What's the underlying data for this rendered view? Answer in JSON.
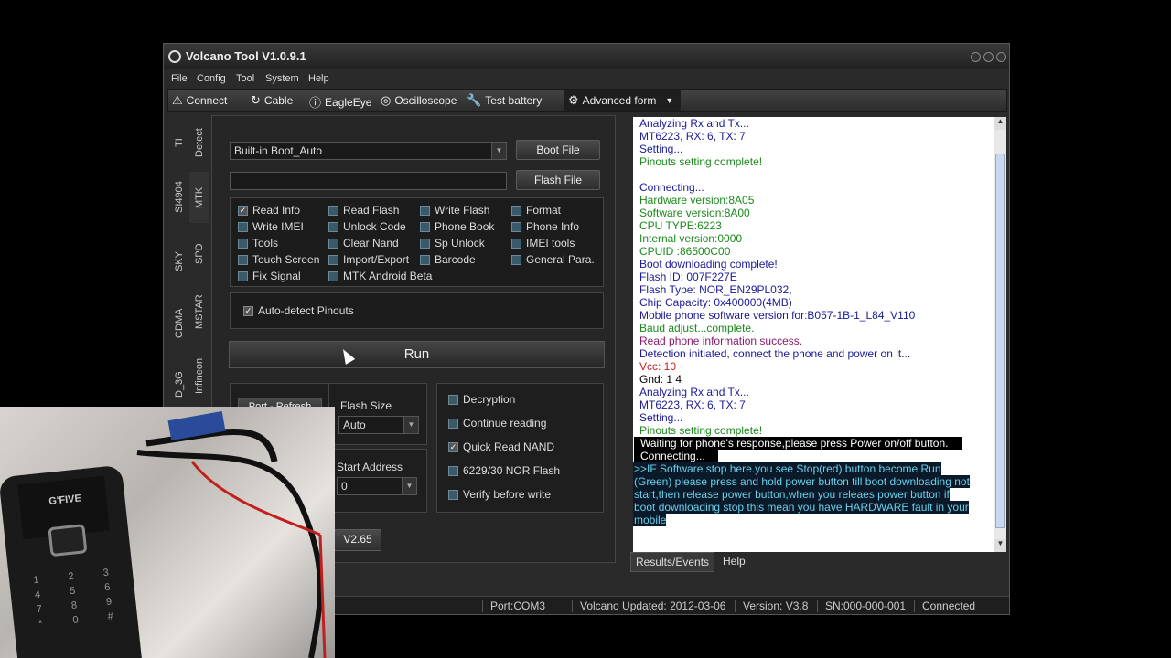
{
  "window": {
    "title": "Volcano Tool V1.0.9.1"
  },
  "menu": [
    "File",
    "Config",
    "Tool",
    "System",
    "Help"
  ],
  "toolbar": {
    "connect": "Connect",
    "cable": "Cable",
    "eagleeye": "EagleEye",
    "oscilloscope": "Oscilloscope",
    "test_battery": "Test battery",
    "advanced": "Advanced form"
  },
  "vtabs": [
    "TI",
    "Detect",
    "SI4904",
    "MTK",
    "SKY",
    "SPD",
    "CDMA",
    "MSTAR",
    "D_3G",
    "Infineon"
  ],
  "boot": {
    "selected": "Built-in Boot_Auto",
    "boot_file": "Boot File",
    "flash_file": "Flash File"
  },
  "options": [
    {
      "label": "Read Info",
      "checked": true
    },
    {
      "label": "Read Flash",
      "checked": false
    },
    {
      "label": "Write Flash",
      "checked": false
    },
    {
      "label": "Format",
      "checked": false
    },
    {
      "label": "Write IMEI",
      "checked": false
    },
    {
      "label": "Unlock Code",
      "checked": false
    },
    {
      "label": "Phone Book",
      "checked": false
    },
    {
      "label": "Phone Info",
      "checked": false
    },
    {
      "label": "Tools",
      "checked": false
    },
    {
      "label": "Clear Nand",
      "checked": false
    },
    {
      "label": "Sp Unlock",
      "checked": false
    },
    {
      "label": "IMEI tools",
      "checked": false
    },
    {
      "label": "Touch Screen",
      "checked": false
    },
    {
      "label": "Import/Export",
      "checked": false
    },
    {
      "label": "Barcode",
      "checked": false
    },
    {
      "label": "General Para.",
      "checked": false
    },
    {
      "label": "Fix Signal",
      "checked": false
    },
    {
      "label": "MTK Android Beta",
      "checked": false
    }
  ],
  "auto_detect": "Auto-detect Pinouts",
  "run": "Run",
  "port": {
    "label": "Port",
    "refresh": "Refresh"
  },
  "flash_size": {
    "label": "Flash Size",
    "value": "Auto"
  },
  "start_address": {
    "label": "Start Address",
    "value": "0"
  },
  "version_btn": "V2.65",
  "right_opts": [
    {
      "label": "Decryption",
      "checked": false
    },
    {
      "label": "Continue reading",
      "checked": false
    },
    {
      "label": "Quick Read NAND",
      "checked": true
    },
    {
      "label": "6229/30 NOR Flash",
      "checked": false
    },
    {
      "label": "Verify before write",
      "checked": false
    }
  ],
  "log": [
    {
      "text": "Analyzing Rx and Tx...",
      "color": "#1a1a9a"
    },
    {
      "text": "MT6223, RX: 6, TX: 7",
      "color": "#1a1a9a"
    },
    {
      "text": "Setting...",
      "color": "#1a1a9a"
    },
    {
      "text": "Pinouts setting complete!",
      "color": "#1a8a1a"
    },
    {
      "text": "",
      "color": "#000"
    },
    {
      "text": "Connecting...",
      "color": "#1a1a9a"
    },
    {
      "text": "Hardware version:8A05",
      "color": "#1a8a1a"
    },
    {
      "text": "Software version:8A00",
      "color": "#1a8a1a"
    },
    {
      "text": "CPU TYPE:6223",
      "color": "#1a8a1a"
    },
    {
      "text": "Internal version:0000",
      "color": "#1a8a1a"
    },
    {
      "text": "CPUID   :86500C00",
      "color": "#1a8a1a"
    },
    {
      "text": "Boot downloading complete!",
      "color": "#1a1a9a"
    },
    {
      "text": "Flash ID: 007F227E",
      "color": "#1a1a9a"
    },
    {
      "text": "Flash Type:  NOR_EN29PL032,",
      "color": "#1a1a9a"
    },
    {
      "text": "Chip Capacity: 0x400000(4MB)",
      "color": "#1a1a9a"
    },
    {
      "text": "Mobile phone software version for:B057-1B-1_L84_V110",
      "color": "#1a1a9a"
    },
    {
      "text": "Baud adjust...complete.",
      "color": "#1a8a1a"
    },
    {
      "text": "Read phone information success.",
      "color": "#8a1a6a"
    },
    {
      "text": "Detection initiated, connect the phone and power on it...",
      "color": "#1a1a9a"
    },
    {
      "text": "Vcc: 10",
      "color": "#d01a1a"
    },
    {
      "text": "Gnd: 1 4",
      "color": "#000"
    },
    {
      "text": "Analyzing Rx and Tx...",
      "color": "#1a1a9a"
    },
    {
      "text": "MT6223, RX: 6, TX: 7",
      "color": "#1a1a9a"
    },
    {
      "text": "Setting...",
      "color": "#1a1a9a"
    },
    {
      "text": "Pinouts setting complete!",
      "color": "#1a8a1a"
    }
  ],
  "log_highlight": [
    " Waiting for phone's response,please press Power on/off button.",
    " Connecting..."
  ],
  "log_note": [
    ">>IF Software stop here.you see Stop(red) button become Run",
    "(Green) please press and hold power button till boot downloading not",
    "start,then release power button,when you releaes power button if",
    "boot downloading stop this mean you have HARDWARE fault in your",
    "mobile"
  ],
  "bottom_tabs": [
    "Results/Events",
    "Help"
  ],
  "status": {
    "port": "Port:COM3",
    "updated": "Volcano Updated: 2012-03-06",
    "version": "Version: V3.8",
    "sn": "SN:000-000-001",
    "state": "Connected"
  },
  "phone_brand": "G'FIVE",
  "keypad": [
    "1",
    "2",
    "3",
    "4",
    "5",
    "6",
    "7",
    "8",
    "9",
    "*",
    "0",
    "#"
  ]
}
